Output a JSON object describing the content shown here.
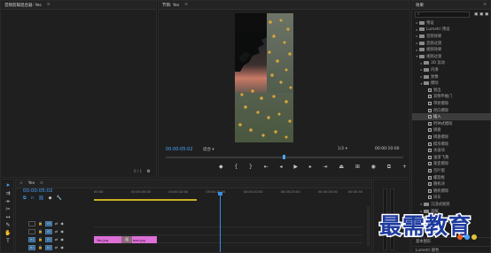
{
  "source_panel": {
    "title": "音频剪辑混合器: Yes",
    "page_indicator": "0 / 1"
  },
  "program_monitor": {
    "title": "节目: Yes",
    "timecode_left": "00:00:05:02",
    "fit_label": "适合",
    "resolution": "1/2",
    "timecode_right": "00:00:10:00"
  },
  "effects_panel": {
    "title": "效果",
    "search_placeholder": "",
    "items": [
      {
        "label": "预设",
        "type": "folder",
        "indent": 0
      },
      {
        "label": "Lumetri 预设",
        "type": "folder",
        "indent": 0
      },
      {
        "label": "音频效果",
        "type": "folder",
        "indent": 0
      },
      {
        "label": "音频过渡",
        "type": "folder",
        "indent": 0
      },
      {
        "label": "视频效果",
        "type": "folder",
        "indent": 0
      },
      {
        "label": "视频过渡",
        "type": "folder",
        "indent": 0,
        "open": true
      },
      {
        "label": "3D 运动",
        "type": "folder",
        "indent": 1
      },
      {
        "label": "内滑",
        "type": "folder",
        "indent": 1
      },
      {
        "label": "划像",
        "type": "folder",
        "indent": 1
      },
      {
        "label": "擦除",
        "type": "folder",
        "indent": 1,
        "open": true
      },
      {
        "label": "划出",
        "type": "fx",
        "indent": 2
      },
      {
        "label": "双侧平推门",
        "type": "fx",
        "indent": 2
      },
      {
        "label": "带状擦除",
        "type": "fx",
        "indent": 2
      },
      {
        "label": "径向擦除",
        "type": "fx",
        "indent": 2
      },
      {
        "label": "插入",
        "type": "fx",
        "indent": 2,
        "selected": true
      },
      {
        "label": "时钟式擦除",
        "type": "fx",
        "indent": 2
      },
      {
        "label": "棋盘",
        "type": "fx",
        "indent": 2
      },
      {
        "label": "棋盘擦除",
        "type": "fx",
        "indent": 2
      },
      {
        "label": "楔形擦除",
        "type": "fx",
        "indent": 2
      },
      {
        "label": "水波块",
        "type": "fx",
        "indent": 2
      },
      {
        "label": "油漆飞溅",
        "type": "fx",
        "indent": 2
      },
      {
        "label": "渐变擦除",
        "type": "fx",
        "indent": 2
      },
      {
        "label": "百叶窗",
        "type": "fx",
        "indent": 2
      },
      {
        "label": "螺旋框",
        "type": "fx",
        "indent": 2
      },
      {
        "label": "随机块",
        "type": "fx",
        "indent": 2
      },
      {
        "label": "随机擦除",
        "type": "fx",
        "indent": 2
      },
      {
        "label": "风车",
        "type": "fx",
        "indent": 2
      },
      {
        "label": "沉浸式视频",
        "type": "folder",
        "indent": 1
      },
      {
        "label": "溶解",
        "type": "folder",
        "indent": 1
      },
      {
        "label": "缩放",
        "type": "folder",
        "indent": 1
      },
      {
        "label": "页面剥落",
        "type": "folder",
        "indent": 1
      }
    ],
    "footer_tabs": [
      "基本图形",
      "Lumetri 颜色"
    ]
  },
  "timeline": {
    "title": "Yes",
    "timecode": "00:00:05:02",
    "ruler_labels": [
      "00:00",
      "00:00:05:00",
      "00:00:10:00",
      "00:00:15:00",
      "00:00:20:00",
      "00:00:25:00",
      "00:00:30:00",
      "00:00:35"
    ],
    "playhead_fraction": 0.117,
    "tracks": [
      {
        "name": "V3",
        "target": ""
      },
      {
        "name": "V2",
        "target": ""
      },
      {
        "name": "V1",
        "target": "V1"
      },
      {
        "name": "A1",
        "target": "A1"
      }
    ],
    "clips": [
      {
        "label": "Yes.jpg",
        "start": 0.0,
        "end": 0.11
      },
      {
        "label": "aaa.jpg",
        "start": 0.135,
        "end": 0.235
      }
    ],
    "transition_label": "插"
  },
  "watermark": {
    "text": "最需教育"
  },
  "colors": {
    "accent": "#4aa3ff",
    "clip": "#dd6fd6",
    "playhead": "#3a8de0",
    "work_area": "#c9b020"
  }
}
